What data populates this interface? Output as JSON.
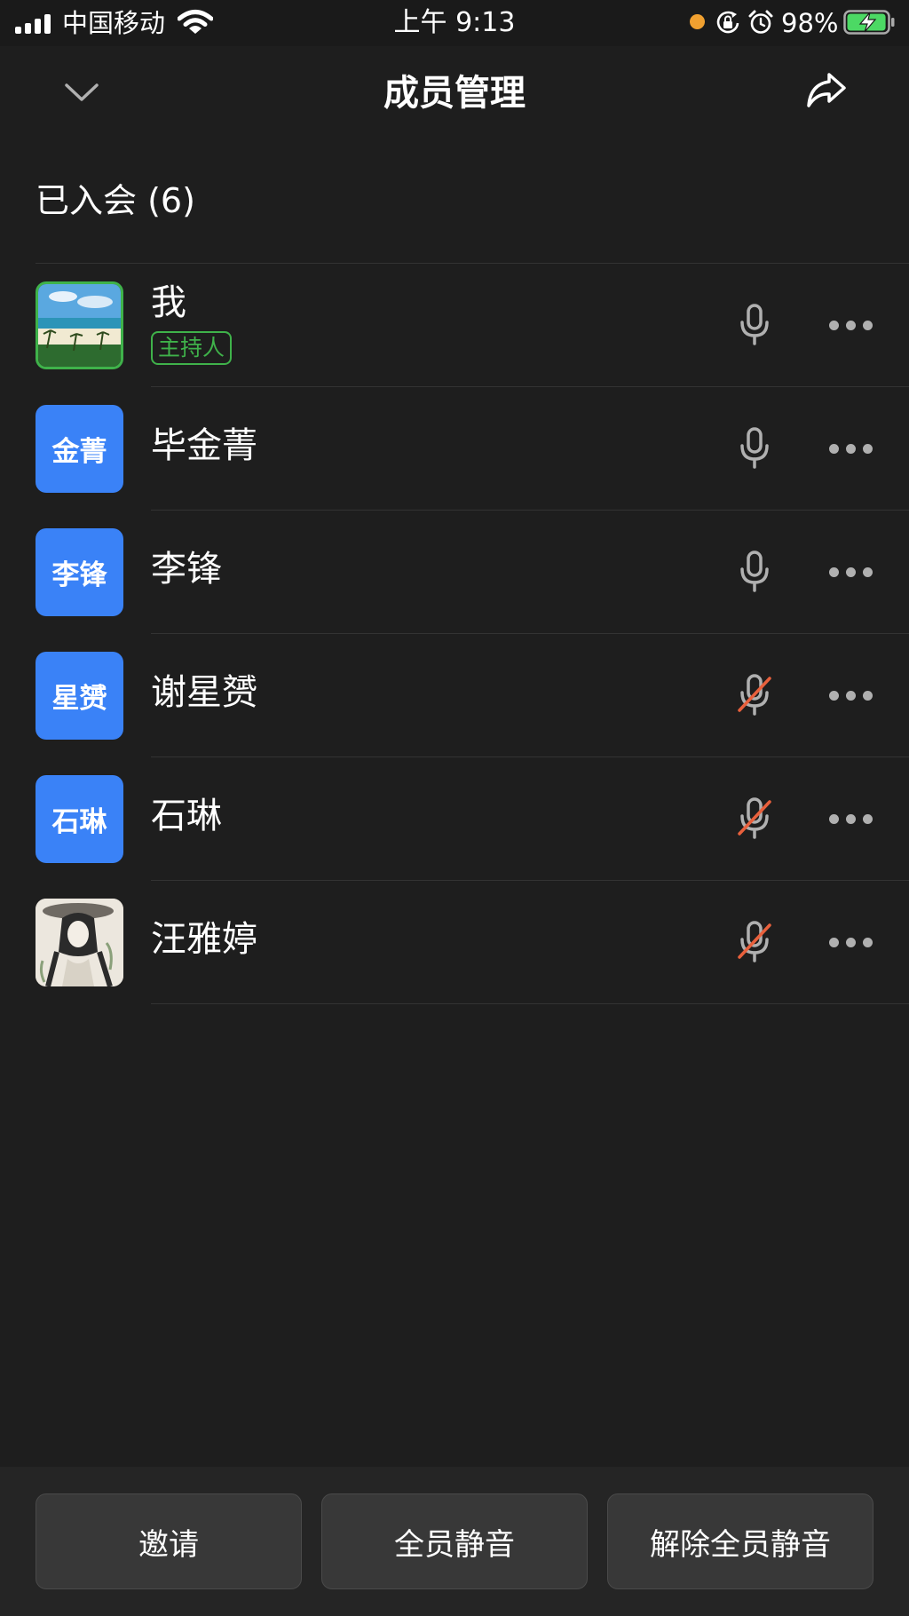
{
  "status_bar": {
    "carrier": "中国移动",
    "time": "上午 9:13",
    "battery_percent": "98%",
    "battery_level": 0.98,
    "charging": true
  },
  "header": {
    "title": "成员管理",
    "back_icon": "chevron-down-icon",
    "share_icon": "share-icon"
  },
  "section": {
    "title": "已入会 (6)"
  },
  "members": [
    {
      "name": "我",
      "avatar_text": "",
      "avatar_type": "photo-beach",
      "badge": "主持人",
      "muted": false
    },
    {
      "name": "毕金菁",
      "avatar_text": "金菁",
      "avatar_type": "initials",
      "muted": false
    },
    {
      "name": "李锋",
      "avatar_text": "李锋",
      "avatar_type": "initials",
      "muted": false
    },
    {
      "name": "谢星赟",
      "avatar_text": "星赟",
      "avatar_type": "initials",
      "muted": true
    },
    {
      "name": "石琳",
      "avatar_text": "石琳",
      "avatar_type": "initials",
      "muted": true
    },
    {
      "name": "汪雅婷",
      "avatar_text": "",
      "avatar_type": "photo-illustration",
      "muted": true
    }
  ],
  "buttons": {
    "invite": "邀请",
    "mute_all": "全员静音",
    "unmute_all": "解除全员静音"
  },
  "colors": {
    "background": "#1e1e1e",
    "avatar_blue": "#3a82f7",
    "host_green": "#3fb24a",
    "muted_red": "#e8603c",
    "icon_gray": "#b0b0b0"
  }
}
